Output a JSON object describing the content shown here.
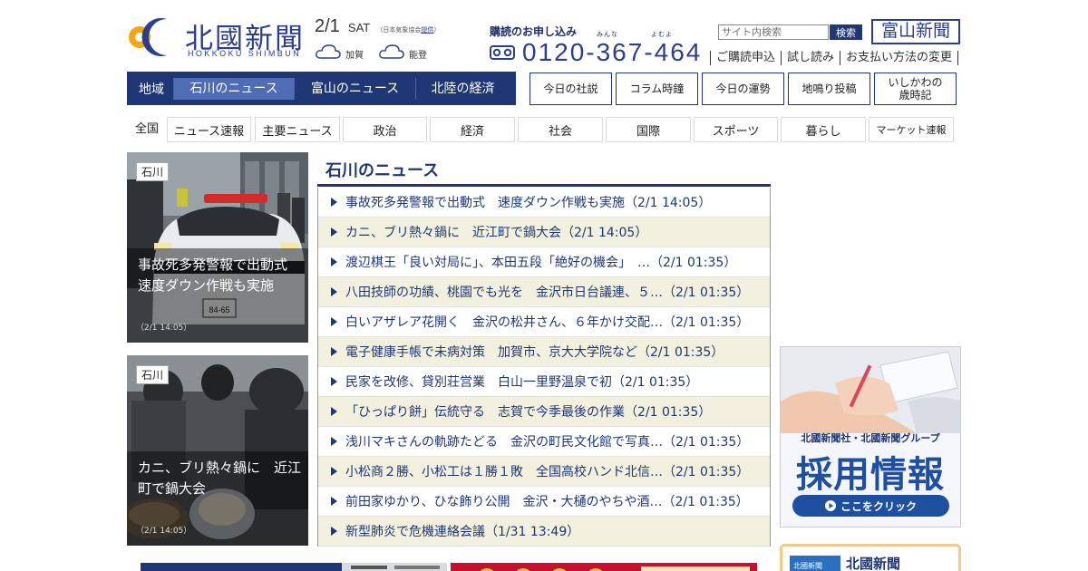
{
  "header": {
    "logo_kanji": "北國新聞",
    "logo_roman": "HOKKOKU SHIMBUN",
    "date_day": "2/1",
    "date_weekday": "SAT",
    "weather_note_prefix": "（日本気象協会",
    "weather_note_link": "提供",
    "weather_note_suffix": "）",
    "weather": [
      {
        "city": "加賀",
        "icon": "cloud-icon"
      },
      {
        "city": "能登",
        "icon": "cloud-icon"
      }
    ],
    "subscription_title": "購読のお申し込み",
    "subscription_ruby_1": "みんな",
    "subscription_ruby_2": "よむよ",
    "subscription_phone": "0120-367-464",
    "search_placeholder": "サイト内検索",
    "search_button": "検索",
    "toyama_logo": "富山新聞",
    "links": [
      "ご購読申込",
      "試し読み",
      "お支払い方法の変更"
    ]
  },
  "region_nav": {
    "label": "地域",
    "tabs": [
      {
        "label": "石川のニュース",
        "active": true
      },
      {
        "label": "富山のニュース",
        "active": false
      },
      {
        "label": "北陸の経済",
        "active": false
      }
    ]
  },
  "feature_buttons": [
    "今日の社説",
    "コラム時鐘",
    "今日の運勢",
    "地鳴り投稿",
    "いしかわの\n歳時記"
  ],
  "categories": {
    "all_label": "全国",
    "items": [
      "ニュース速報",
      "主要ニュース",
      "政治",
      "経済",
      "社会",
      "国際",
      "スポーツ",
      "暮らし",
      "マーケット速報"
    ]
  },
  "photo_cards": [
    {
      "tag": "石川",
      "title": "事故死多発警報で出動式　速度ダウン作戦も実施",
      "time": "（2/1 14:05）",
      "plate": "84-65"
    },
    {
      "tag": "石川",
      "title": "カニ、ブリ熱々鍋に　近江町で鍋大会",
      "time": "（2/1 14:05）"
    }
  ],
  "news": {
    "title": "石川のニュース",
    "items": [
      "事故死多発警報で出動式　速度ダウン作戦も実施（2/1 14:05）",
      "カニ、ブリ熱々鍋に　近江町で鍋大会（2/1 14:05）",
      "渡辺棋王「良い対局に」、本田五段「絶好の機会」　…（2/1 01:35）",
      "八田技師の功績、桃園でも光を　金沢市日台議連、５…（2/1 01:35）",
      "白いアザレア花開く　金沢の松井さん、６年かけ交配…（2/1 01:35）",
      "電子健康手帳で未病対策　加賀市、京大大学院など（2/1 01:35）",
      "民家を改修、貸別荘営業　白山一里野温泉で初（2/1 01:35）",
      "「ひっぱり餅」伝統守る　志賀で今季最後の作業（2/1 01:35）",
      "浅川マキさんの軌跡たどる　金沢の町民文化館で写真…（2/1 01:35）",
      "小松商２勝、小松工は１勝１敗　全国高校ハンド北信…（2/1 01:35）",
      "前田家ゆかり、ひな飾り公開　金沢・大樋のやちや酒…（2/1 01:35）",
      "新型肺炎で危機連絡会議（1/31 13:49）"
    ]
  },
  "recruit_ad": {
    "company": "北國新聞社・北國新聞グループ",
    "headline": "採用情報",
    "button": "ここをクリック"
  },
  "mini_banner": {
    "logo_text": "北國新聞",
    "label": "北國新聞"
  },
  "colors": {
    "brand_navy": "#1f3774",
    "active_tab": "#4e6db5",
    "alt_row": "#f2f0df",
    "ad_blue": "#1f4fa0"
  }
}
